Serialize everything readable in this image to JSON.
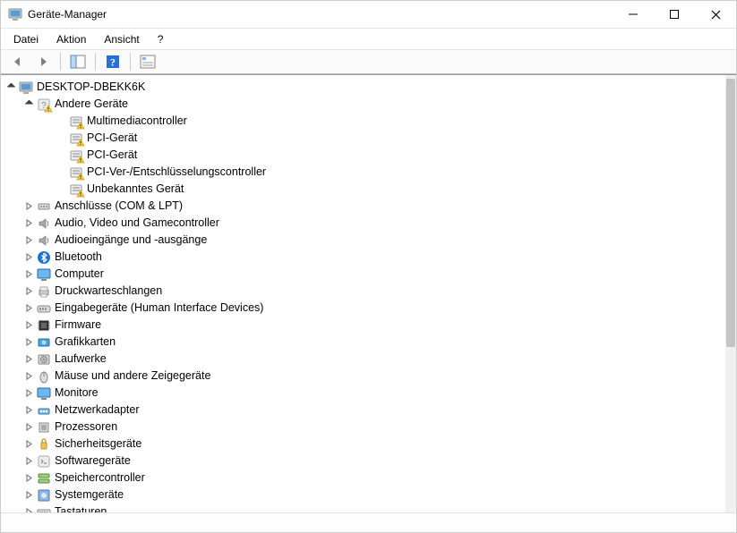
{
  "window": {
    "title": "Geräte-Manager"
  },
  "menu": {
    "file": "Datei",
    "action": "Aktion",
    "view": "Ansicht",
    "help": "?"
  },
  "tree": {
    "root": "DESKTOP-DBEKK6K",
    "other_devices": {
      "label": "Andere Geräte",
      "children": [
        "Multimediacontroller",
        "PCI-Gerät",
        "PCI-Gerät",
        "PCI-Ver-/Entschlüsselungscontroller",
        "Unbekanntes Gerät"
      ]
    },
    "categories": [
      "Anschlüsse (COM & LPT)",
      "Audio, Video und Gamecontroller",
      "Audioeingänge und -ausgänge",
      "Bluetooth",
      "Computer",
      "Druckwarteschlangen",
      "Eingabegeräte (Human Interface Devices)",
      "Firmware",
      "Grafikkarten",
      "Laufwerke",
      "Mäuse und andere Zeigegeräte",
      "Monitore",
      "Netzwerkadapter",
      "Prozessoren",
      "Sicherheitsgeräte",
      "Softwaregeräte",
      "Speichercontroller",
      "Systemgeräte",
      "Tastaturen"
    ]
  }
}
